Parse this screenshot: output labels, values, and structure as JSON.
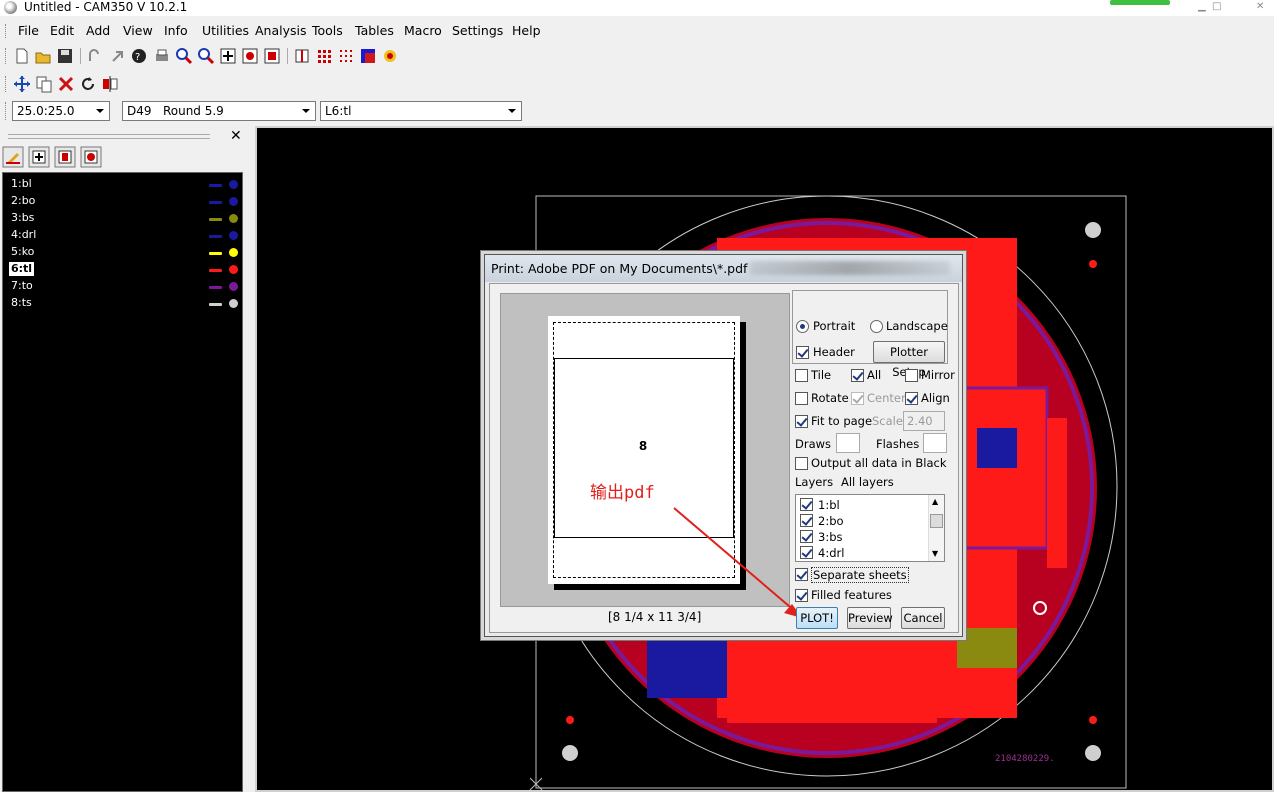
{
  "window": {
    "title": "Untitled - CAM350 V 10.2.1"
  },
  "menu": [
    "File",
    "Edit",
    "Add",
    "View",
    "Info",
    "Utilities",
    "Analysis",
    "Tools",
    "Tables",
    "Macro",
    "Settings",
    "Help"
  ],
  "toolbar3": {
    "grid_value": "25.0:25.0",
    "aperture_value": "D49   Round 5.9",
    "layer_value": "L6:tl"
  },
  "layers_panel": {
    "layers": [
      {
        "name": "1:bl",
        "color": "#1a1aa0",
        "active": false
      },
      {
        "name": "2:bo",
        "color": "#1a1aa0",
        "active": false
      },
      {
        "name": "3:bs",
        "color": "#8a8a10",
        "active": false
      },
      {
        "name": "4:drl",
        "color": "#1a1aa0",
        "active": false
      },
      {
        "name": "5:ko",
        "color": "#ffff00",
        "active": false
      },
      {
        "name": "6:tl",
        "color": "#ff1a1a",
        "active": true
      },
      {
        "name": "7:to",
        "color": "#7a1a9a",
        "active": false
      },
      {
        "name": "8:ts",
        "color": "#d0d0d0",
        "active": false
      }
    ]
  },
  "board": {
    "code": "2104280229."
  },
  "print_dialog": {
    "title": "Print: Adobe PDF on My Documents\\*.pdf",
    "page_number": "8",
    "page_size": "[8 1/4 x 11 3/4]",
    "annotation": "输出pdf",
    "portrait": "Portrait",
    "landscape": "Landscape",
    "orientation": "portrait",
    "header": "Header",
    "plotter_setup": "Plotter Setup",
    "tile": "Tile",
    "all": "All",
    "mirror": "Mirror",
    "rotate": "Rotate",
    "center": "Center",
    "align": "Align",
    "fit_to_page": "Fit to page",
    "scale_label": "Scale",
    "scale_value": "2.40",
    "draws": "Draws",
    "flashes": "Flashes",
    "output_black": "Output all data in Black",
    "layers_label": "Layers",
    "layers_value": "All layers",
    "layer_items": [
      "1:bl",
      "2:bo",
      "3:bs",
      "4:drl"
    ],
    "separate_sheets": "Separate sheets",
    "filled_features": "Filled features",
    "plot_button": "PLOT!",
    "preview_button": "Preview",
    "cancel_button": "Cancel"
  }
}
